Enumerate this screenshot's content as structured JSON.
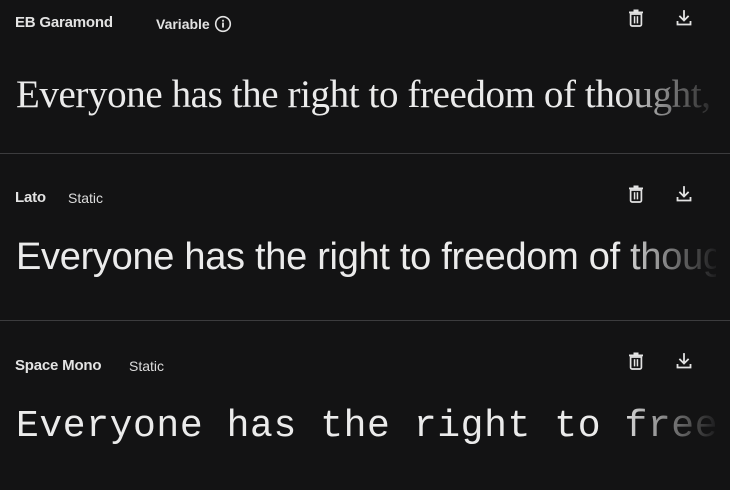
{
  "fonts": [
    {
      "name": "EB Garamond",
      "type": "Variable",
      "has_info": true,
      "sample": "Everyone has the right to freedom of thought, conscience and religion"
    },
    {
      "name": "Lato",
      "type": "Static",
      "has_info": false,
      "sample": "Everyone has the right to freedom of thought, conscience and religion"
    },
    {
      "name": "Space Mono",
      "type": "Static",
      "has_info": false,
      "sample": "Everyone has the right to freedom of thought, conscience and religion"
    }
  ],
  "icons": {
    "delete": "trash-icon",
    "download": "download-icon",
    "info": "info-icon"
  },
  "colors": {
    "background": "#131314",
    "text": "#e3e3e3",
    "divider": "#3c3c3e"
  }
}
